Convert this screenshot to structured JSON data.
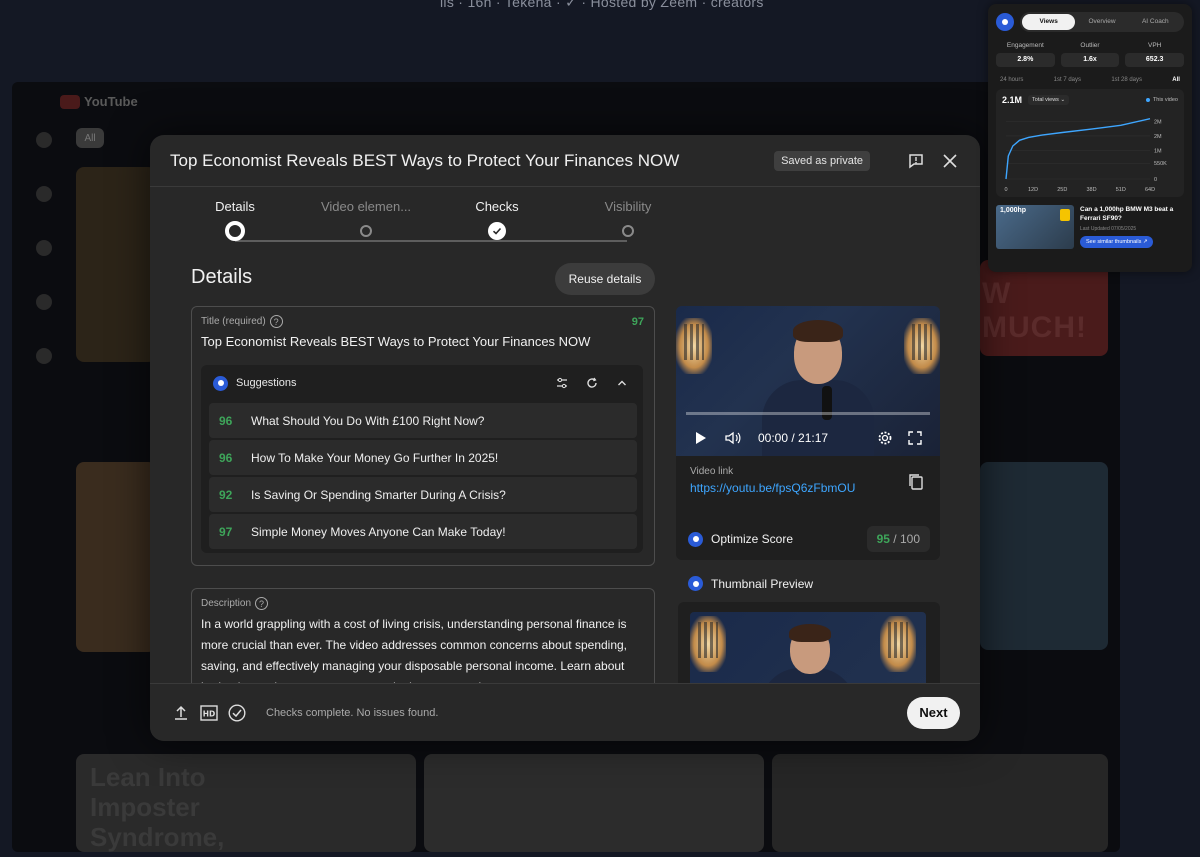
{
  "background": {
    "top_text": "ils · 16h · Tekena · ✓ · Hosted by Zeem · creators",
    "logo": "YouTube",
    "chip": "All",
    "bottom_text": [
      "Lean Into",
      "Imposter",
      "Syndrome,"
    ],
    "right_text": "W MUCH!"
  },
  "modal": {
    "title": "Top Economist Reveals BEST Ways to Protect Your Finances NOW",
    "saved_badge": "Saved as private",
    "steps": [
      {
        "label": "Details",
        "state": "active"
      },
      {
        "label": "Video elemen...",
        "state": "pending"
      },
      {
        "label": "Checks",
        "state": "done"
      },
      {
        "label": "Visibility",
        "state": "pending"
      }
    ],
    "details_heading": "Details",
    "reuse_button": "Reuse details",
    "title_field": {
      "label": "Title (required)",
      "score": "97",
      "value": "Top Economist Reveals BEST Ways to Protect Your Finances NOW"
    },
    "suggestions": {
      "heading": "Suggestions",
      "items": [
        {
          "score": "96",
          "text": "What Should You Do With £100 Right Now?"
        },
        {
          "score": "96",
          "text": "How To Make Your Money Go Further In 2025!"
        },
        {
          "score": "92",
          "text": "Is Saving Or Spending Smarter During A Crisis?"
        },
        {
          "score": "97",
          "text": "Simple Money Moves Anyone Can Make Today!"
        }
      ]
    },
    "description": {
      "label": "Description",
      "value": "In a world grappling with a cost of living crisis, understanding personal finance is more crucial than ever. The video addresses common concerns about spending, saving, and effectively managing your disposable personal income. Learn about budgeting and money management in these uncertain"
    },
    "video": {
      "time": "00:00 / 21:17",
      "link_label": "Video link",
      "link": "https://youtu.be/fpsQ6zFbmOU"
    },
    "optimize": {
      "label": "Optimize Score",
      "score": "95",
      "total": "/ 100"
    },
    "thumbnail_preview": "Thumbnail Preview",
    "footer": {
      "status": "Checks complete. No issues found.",
      "next": "Next"
    }
  },
  "widget": {
    "tabs": [
      {
        "label": "Views",
        "active": true
      },
      {
        "label": "Overview",
        "active": false
      },
      {
        "label": "AI Coach",
        "active": false
      }
    ],
    "metrics": [
      {
        "key": "Engagement",
        "value": "2.8%"
      },
      {
        "key": "Outlier",
        "value": "1.6x"
      },
      {
        "key": "VPH",
        "value": "652.3"
      }
    ],
    "ranges": [
      {
        "label": "24 hours",
        "on": false
      },
      {
        "label": "1st 7 days",
        "on": false
      },
      {
        "label": "1st 28 days",
        "on": false
      },
      {
        "label": "All",
        "on": true
      }
    ],
    "total": "2.1M",
    "select": "Total views",
    "legend": "This video",
    "recommendation": {
      "tag": "1,000hp",
      "title": "Can a 1,000hp BMW M3 beat a Ferrari SF90?",
      "date": "Last Updated 07/05/2025",
      "button": "See similar thumbnails ↗"
    }
  },
  "chart_data": {
    "type": "line",
    "title": "",
    "xlabel": "",
    "ylabel": "",
    "x_ticks": [
      "0",
      "12D",
      "25D",
      "38D",
      "51D",
      "64D"
    ],
    "y_ticks": [
      "0",
      "550K",
      "1M",
      "2M",
      "2M"
    ],
    "ylim": [
      0,
      2300000
    ],
    "series": [
      {
        "name": "This video",
        "x": [
          0,
          1,
          3,
          6,
          10,
          16,
          25,
          38,
          51,
          64
        ],
        "values": [
          0,
          800000,
          1150000,
          1350000,
          1450000,
          1530000,
          1620000,
          1740000,
          1870000,
          2100000
        ]
      }
    ],
    "grid": true
  },
  "colors": {
    "accent": "#3ea6ff",
    "score_green": "#3ea55a",
    "brand_blue": "#2a5bd7"
  }
}
